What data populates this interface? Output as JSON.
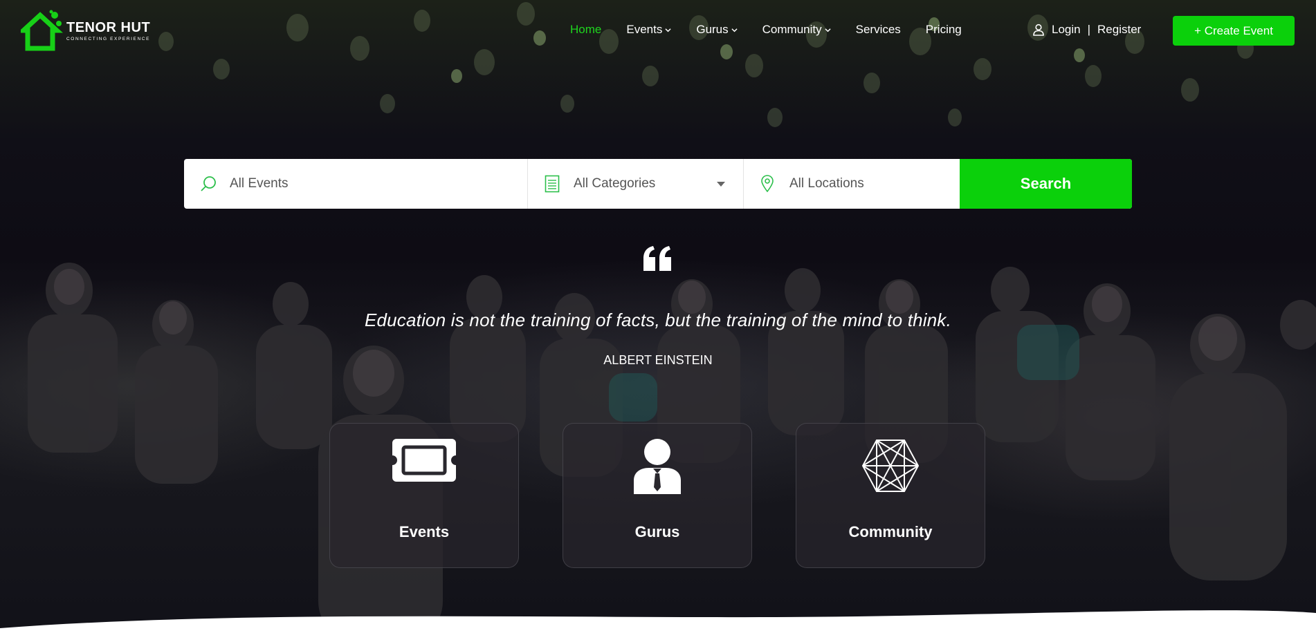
{
  "brand": {
    "name": "TENOR HUT",
    "tagline": "CONNECTING EXPERIENCE",
    "accent_color": "#0bd00b"
  },
  "nav": {
    "items": [
      {
        "label": "Home",
        "active": true,
        "dropdown": false
      },
      {
        "label": "Events",
        "active": false,
        "dropdown": true
      },
      {
        "label": "Gurus",
        "active": false,
        "dropdown": true
      },
      {
        "label": "Community",
        "active": false,
        "dropdown": true
      },
      {
        "label": "Services",
        "active": false,
        "dropdown": false
      },
      {
        "label": "Pricing",
        "active": false,
        "dropdown": false
      }
    ],
    "login": "Login",
    "separator": "|",
    "register": "Register",
    "create_event": "+ Create Event"
  },
  "search": {
    "events_placeholder": "All Events",
    "categories_value": "All Categories",
    "locations_placeholder": "All Locations",
    "button": "Search"
  },
  "quote": {
    "text": "Education is not the training of facts, but the training of the mind to think.",
    "author": "ALBERT EINSTEIN"
  },
  "cards": [
    {
      "label": "Events",
      "icon": "ticket-icon"
    },
    {
      "label": "Gurus",
      "icon": "person-tie-icon"
    },
    {
      "label": "Community",
      "icon": "network-icon"
    }
  ]
}
